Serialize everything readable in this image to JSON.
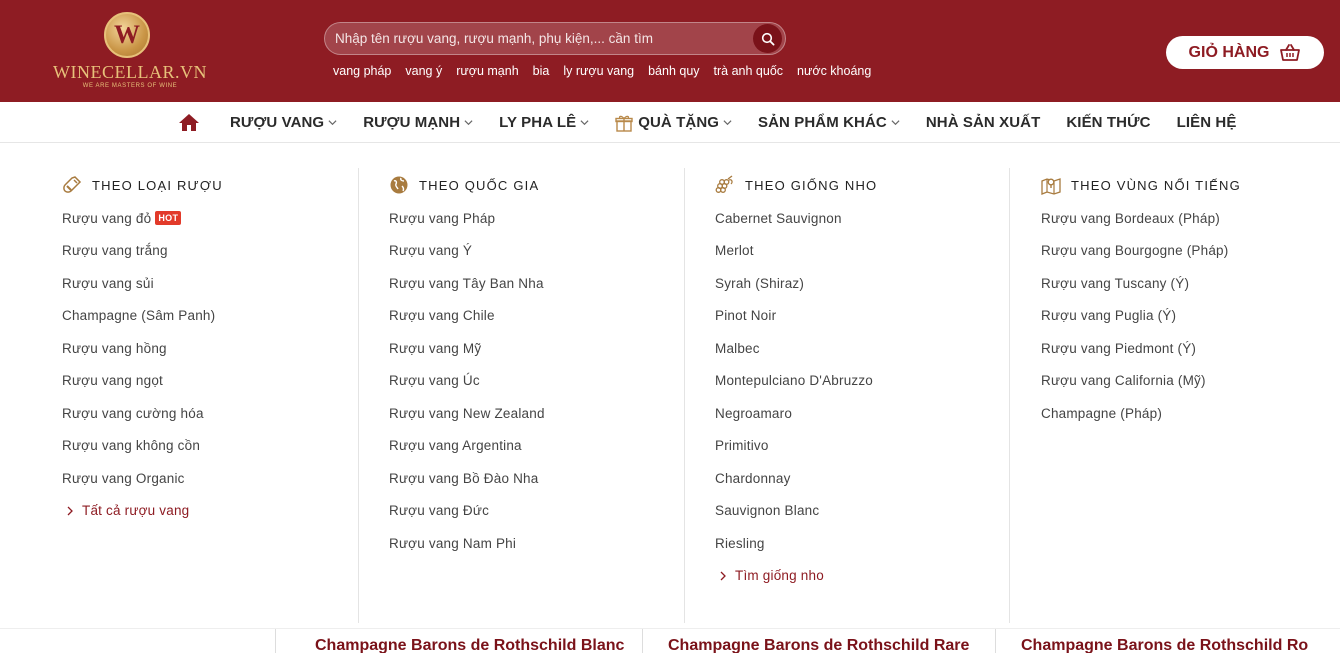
{
  "header": {
    "logo_text": "WINECELLAR.VN",
    "logo_tagline": "WE ARE MASTERS OF WINE",
    "logo_letter": "W",
    "search_placeholder": "Nhập tên rượu vang, rượu mạnh, phụ kiện,... cần tìm",
    "quick_links": [
      "vang pháp",
      "vang ý",
      "rượu mạnh",
      "bia",
      "ly rượu vang",
      "bánh quy",
      "trà anh quốc",
      "nước khoáng"
    ],
    "cart_label": "GIỎ HÀNG"
  },
  "nav": {
    "items": [
      {
        "label": "RƯỢU VANG",
        "has_dropdown": true
      },
      {
        "label": "RƯỢU MẠNH",
        "has_dropdown": true
      },
      {
        "label": "LY PHA LÊ",
        "has_dropdown": true
      },
      {
        "label": "QUÀ TẶNG",
        "has_dropdown": true,
        "icon": "gift-icon"
      },
      {
        "label": "SẢN PHẨM KHÁC",
        "has_dropdown": true
      },
      {
        "label": "NHÀ SẢN XUẤT",
        "has_dropdown": false
      },
      {
        "label": "KIẾN THỨC",
        "has_dropdown": false
      },
      {
        "label": "LIÊN HỆ",
        "has_dropdown": false
      }
    ]
  },
  "mega_menu": {
    "columns": [
      {
        "heading": "THEO LOẠI RƯỢU",
        "icon": "wine-bottle-icon",
        "items": [
          "Rượu vang đỏ",
          "Rượu vang trắng",
          "Rượu vang sủi",
          "Champagne (Sâm Panh)",
          "Rượu vang hồng",
          "Rượu vang ngọt",
          "Rượu vang cường hóa",
          "Rượu vang không cồn",
          "Rượu vang Organic"
        ],
        "hot_badge": "HOT",
        "more": "Tất cả rượu vang"
      },
      {
        "heading": "THEO QUỐC GIA",
        "icon": "globe-icon",
        "items": [
          "Rượu vang Pháp",
          "Rượu vang Ý",
          "Rượu vang Tây Ban Nha",
          "Rượu vang Chile",
          "Rượu vang Mỹ",
          "Rượu vang Úc",
          "Rượu vang New Zealand",
          "Rượu vang Argentina",
          "Rượu vang Bồ Đào Nha",
          "Rượu vang Đức",
          "Rượu vang Nam Phi"
        ]
      },
      {
        "heading": "THEO GIỐNG NHO",
        "icon": "grapes-icon",
        "items": [
          "Cabernet Sauvignon",
          "Merlot",
          "Syrah (Shiraz)",
          "Pinot Noir",
          "Malbec",
          "Montepulciano D'Abruzzo",
          "Negroamaro",
          "Primitivo",
          "Chardonnay",
          "Sauvignon Blanc",
          "Riesling"
        ],
        "more": "Tìm giống nho"
      },
      {
        "heading": "THEO VÙNG NỔI TIẾNG",
        "icon": "map-pin-icon",
        "items": [
          "Rượu vang Bordeaux (Pháp)",
          "Rượu vang Bourgogne (Pháp)",
          "Rượu vang Tuscany (Ý)",
          "Rượu vang Puglia (Ý)",
          "Rượu vang Piedmont (Ý)",
          "Rượu vang California (Mỹ)",
          "Champagne (Pháp)"
        ]
      }
    ]
  },
  "below_fold": {
    "product_titles": [
      "Champagne Barons de Rothschild Blanc",
      "Champagne Barons de Rothschild Rare",
      "Champagne Barons de Rothschild Ro"
    ]
  },
  "colors": {
    "brand": "#8e1c23",
    "gold": "#e7c17a",
    "hot": "#e23a2a"
  }
}
